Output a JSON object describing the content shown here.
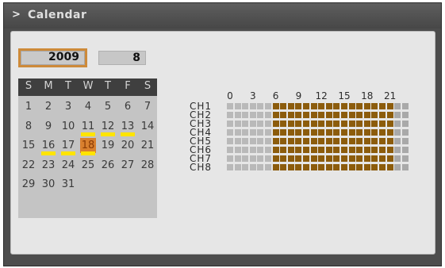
{
  "window": {
    "title": "Calendar",
    "arrow": ">"
  },
  "date": {
    "year": "2009",
    "month": "8"
  },
  "calendar": {
    "weekdays": [
      "S",
      "M",
      "T",
      "W",
      "T",
      "F",
      "S"
    ],
    "weeks": [
      [
        "1",
        "2",
        "3",
        "4",
        "5",
        "6",
        "7"
      ],
      [
        "8",
        "9",
        "10",
        "11",
        "12",
        "13",
        "14"
      ],
      [
        "15",
        "16",
        "17",
        "18",
        "19",
        "20",
        "21"
      ],
      [
        "22",
        "23",
        "24",
        "25",
        "26",
        "27",
        "28"
      ],
      [
        "29",
        "30",
        "31",
        "",
        "",
        "",
        ""
      ]
    ],
    "marked_days": [
      "11",
      "12",
      "13",
      "16",
      "17",
      "18"
    ],
    "selected_day": "18"
  },
  "schedule": {
    "hour_labels": [
      "0",
      "3",
      "6",
      "9",
      "12",
      "15",
      "18",
      "21"
    ],
    "channels": [
      "CH1",
      "CH2",
      "CH3",
      "CH4",
      "CH5",
      "CH6",
      "CH7",
      "CH8"
    ],
    "recorded_hours": [
      6,
      7,
      8,
      9,
      10,
      11,
      12,
      13,
      14,
      15,
      16,
      17,
      18,
      19,
      20,
      21
    ],
    "colors": {
      "recorded": "#8c5c0c",
      "empty": "#b9b9b9",
      "selected_day": "#d9802e",
      "event_mark": "#ffe400"
    }
  }
}
